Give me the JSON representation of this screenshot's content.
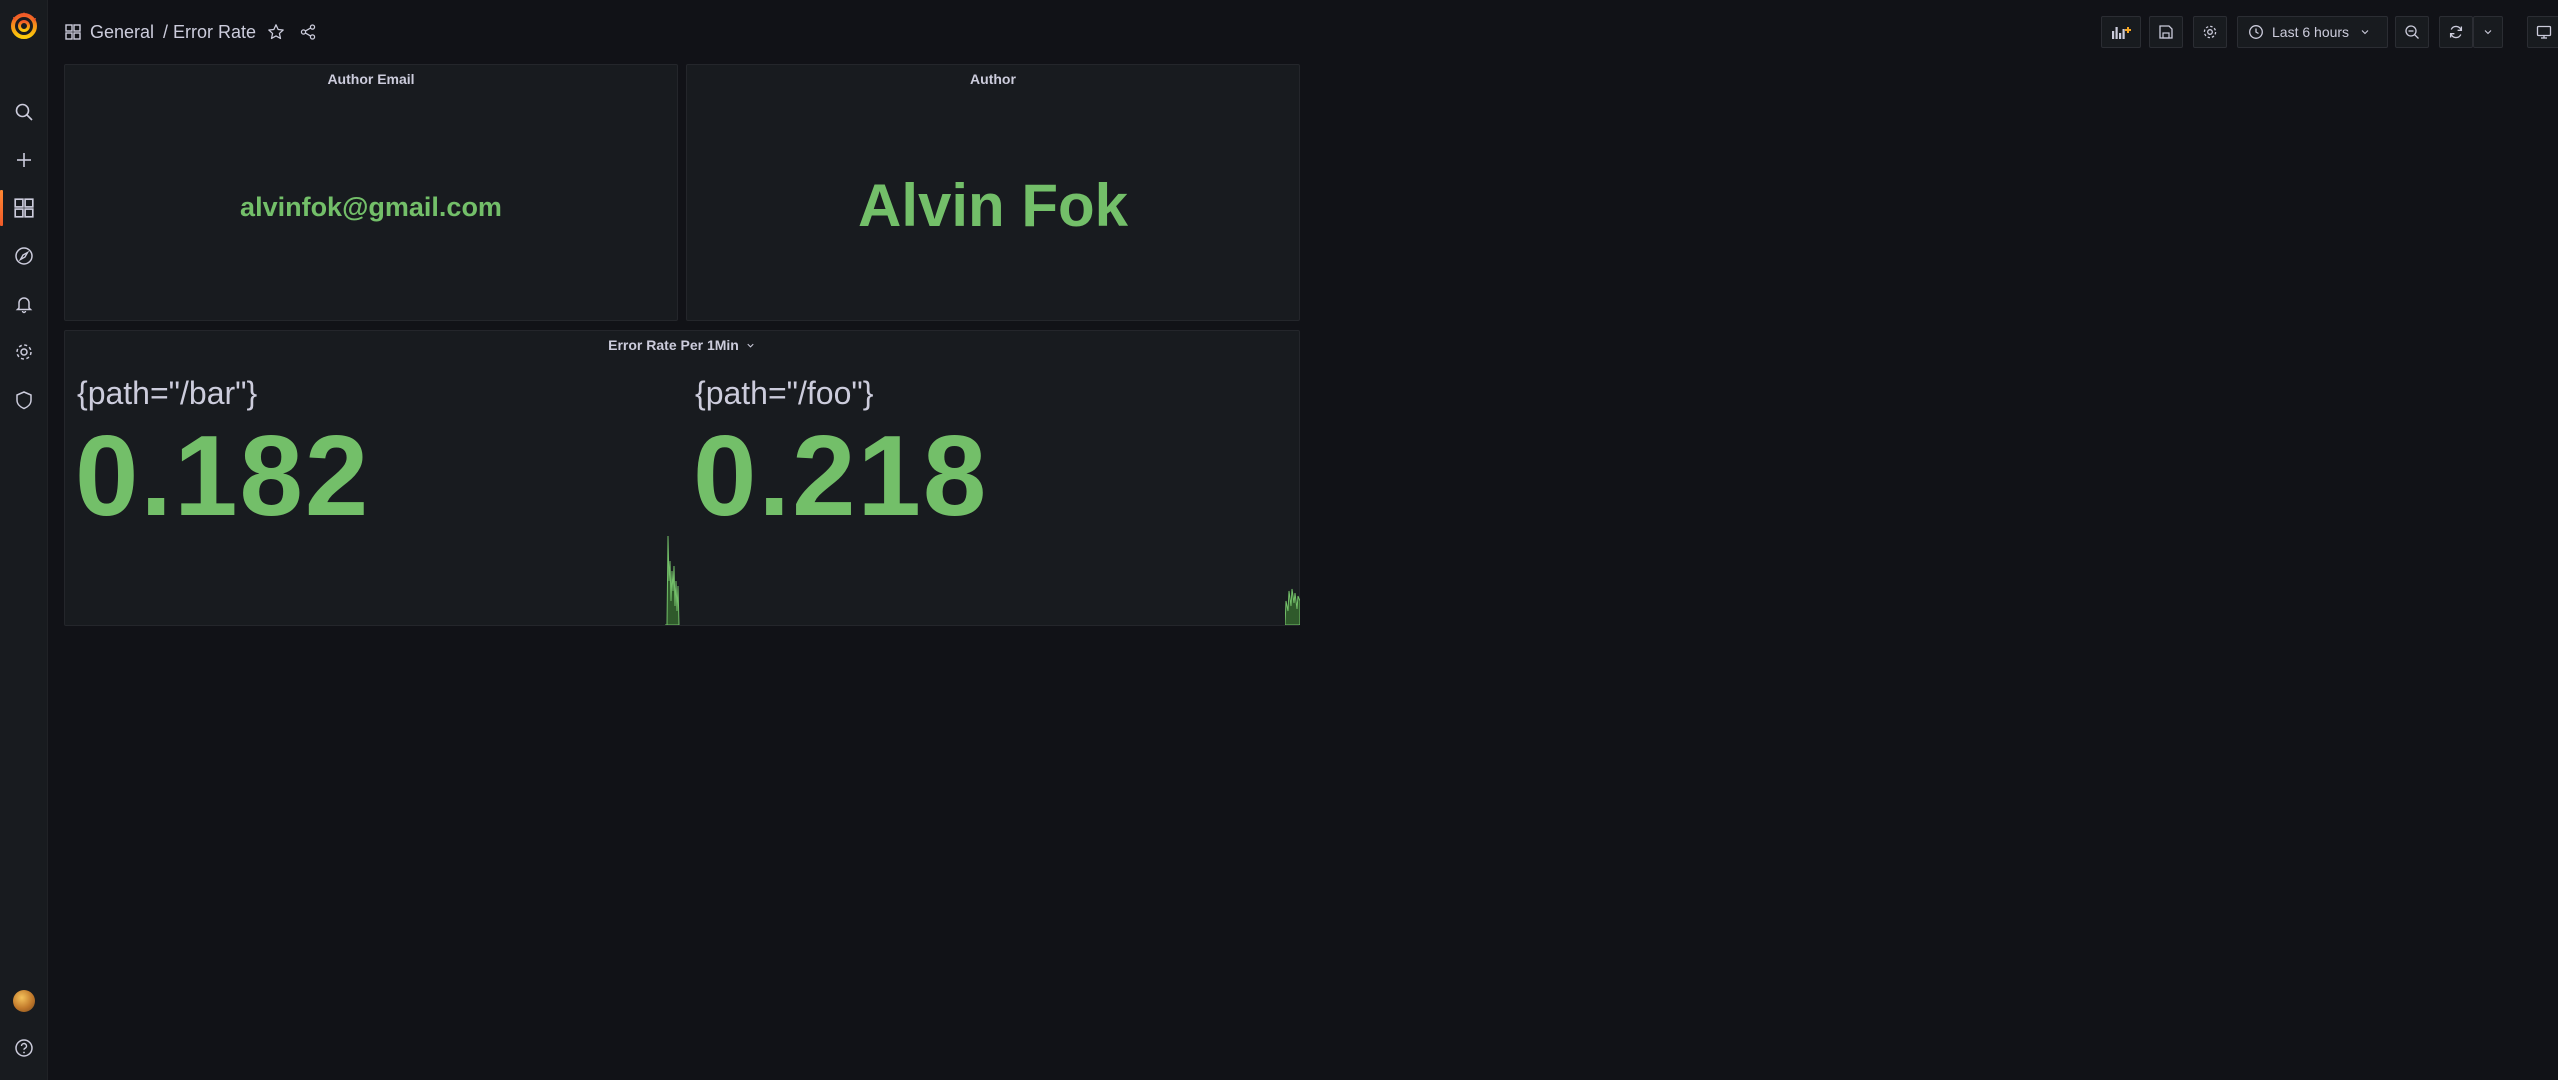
{
  "breadcrumb": {
    "folder": "General",
    "title": "/ Error Rate"
  },
  "toolbar": {
    "time_range": "Last 6 hours"
  },
  "icons": {
    "logo": "grafana-logo",
    "sidebar": [
      "search-icon",
      "plus-icon",
      "dashboards-icon",
      "explore-icon",
      "bell-icon",
      "gear-icon",
      "shield-icon"
    ],
    "sidebar_bottom": [
      "avatar",
      "help-icon"
    ],
    "toolbar": [
      "add-panel-icon",
      "save-icon",
      "settings-icon",
      "clock-icon",
      "chevron-down-icon",
      "zoom-out-icon",
      "refresh-icon",
      "chevron-down-icon",
      "tv-icon"
    ]
  },
  "colors": {
    "accent": "#f05a28",
    "value_green": "#73bf69",
    "background": "#111217",
    "panel": "#181b1f"
  },
  "panels": {
    "author_email": {
      "title": "Author Email",
      "value": "alvinfok@gmail.com"
    },
    "author": {
      "title": "Author",
      "value": "Alvin Fok"
    },
    "error_rate": {
      "title": "Error Rate Per 1Min",
      "series": [
        {
          "name": "{path=\"/bar\"}",
          "value": "0.182"
        },
        {
          "name": "{path=\"/foo\"}",
          "value": "0.218"
        }
      ]
    }
  }
}
